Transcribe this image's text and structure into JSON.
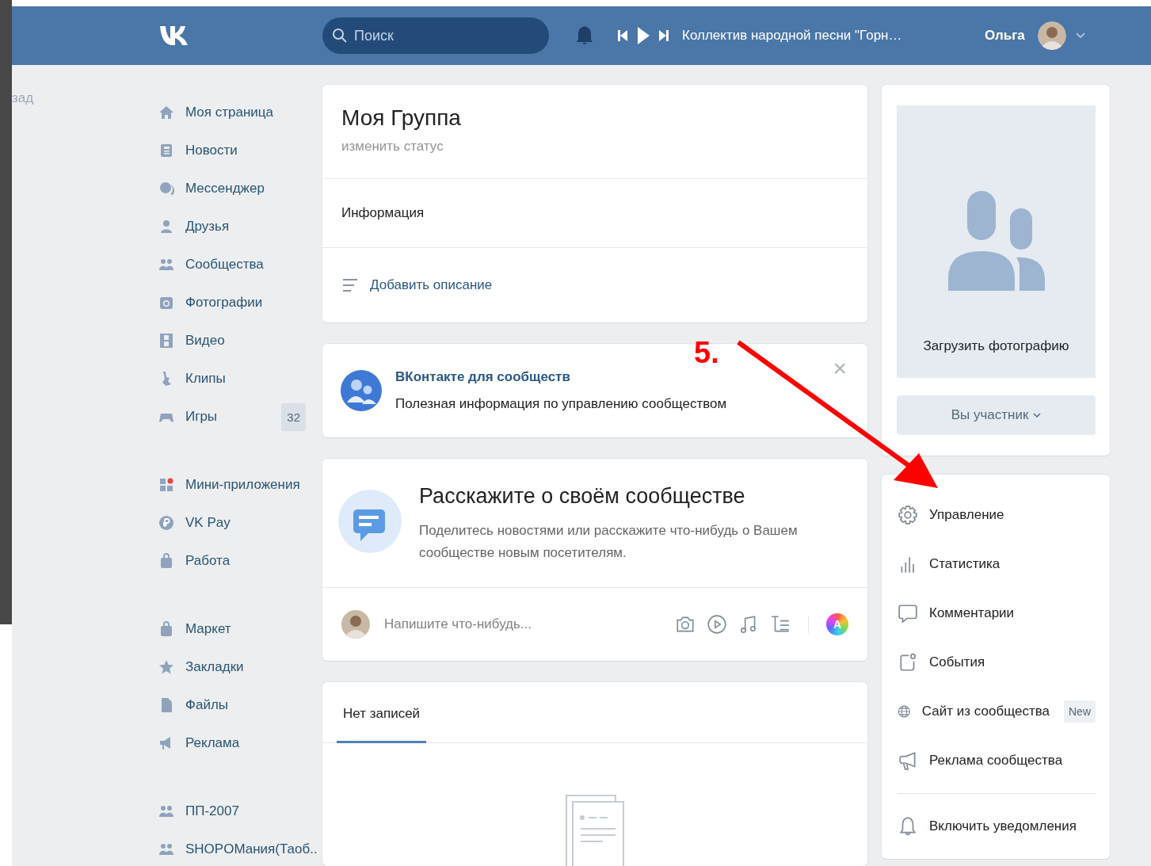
{
  "frame": {
    "back_link": "зад"
  },
  "header": {
    "search": {
      "placeholder": "Поиск"
    },
    "player": {
      "track": "Коллектив народной песни \"Горн…"
    },
    "user": {
      "name": "Ольга"
    }
  },
  "sidebar": {
    "groups": [
      {
        "items": [
          {
            "label": "Моя страница"
          },
          {
            "label": "Новости"
          },
          {
            "label": "Мессенджер"
          },
          {
            "label": "Друзья"
          },
          {
            "label": "Сообщества"
          },
          {
            "label": "Фотографии"
          },
          {
            "label": "Видео"
          },
          {
            "label": "Клипы"
          },
          {
            "label": "Игры",
            "badge": "32"
          }
        ]
      },
      {
        "items": [
          {
            "label": "Мини-приложения"
          },
          {
            "label": "VK Pay"
          },
          {
            "label": "Работа"
          }
        ]
      },
      {
        "items": [
          {
            "label": "Маркет"
          },
          {
            "label": "Закладки"
          },
          {
            "label": "Файлы"
          },
          {
            "label": "Реклама"
          }
        ]
      },
      {
        "items": [
          {
            "label": "ПП-2007"
          },
          {
            "label": "SHOPOМания(Таоб.."
          }
        ]
      }
    ]
  },
  "group": {
    "title": "Моя Группа",
    "status": "изменить статус",
    "info_title": "Информация",
    "add_description": "Добавить описание"
  },
  "promo": {
    "title": "ВКонтакте для сообществ",
    "text": "Полезная информация по управлению сообществом",
    "close": "×"
  },
  "tell": {
    "title": "Расскажите о своём сообществе",
    "text": "Поделитесь новостями или расскажите что-нибудь о Вашем сообществе новым посетителям."
  },
  "composer": {
    "placeholder": "Напишите что-нибудь...",
    "art_button": "A"
  },
  "wall": {
    "tabs": [
      {
        "label": "Нет записей",
        "selected": true
      }
    ]
  },
  "photo": {
    "upload": "Загрузить фотографию",
    "member_button": "Вы участник"
  },
  "actions": {
    "groups": [
      {
        "items": [
          {
            "label": "Управление"
          },
          {
            "label": "Статистика"
          },
          {
            "label": "Комментарии"
          },
          {
            "label": "События"
          },
          {
            "label": "Сайт из сообщества",
            "badge": "New"
          },
          {
            "label": "Реклама сообщества"
          }
        ]
      },
      {
        "items": [
          {
            "label": "Включить уведомления"
          }
        ]
      }
    ]
  },
  "annotation": {
    "label": "5."
  }
}
